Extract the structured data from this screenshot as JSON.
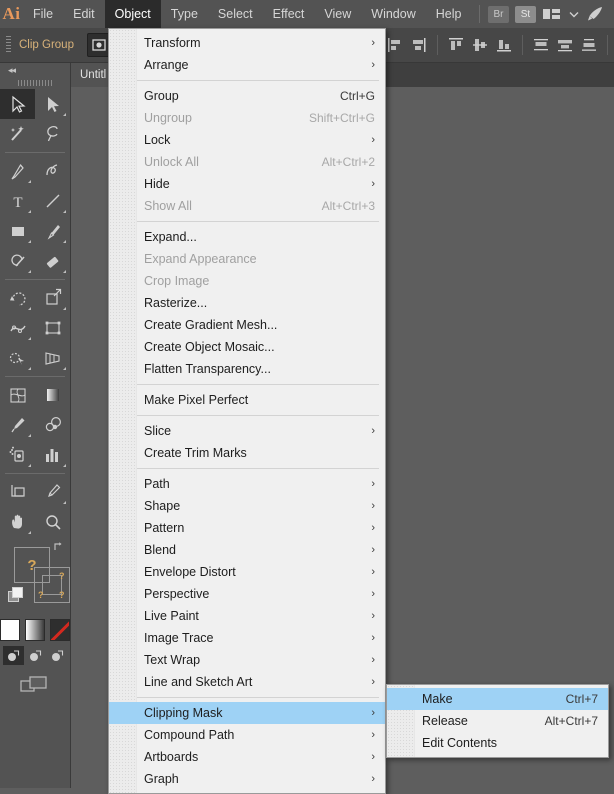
{
  "app": {
    "logo": "Ai"
  },
  "menubar": {
    "items": [
      {
        "label": "File",
        "active": false
      },
      {
        "label": "Edit",
        "active": false
      },
      {
        "label": "Object",
        "active": true
      },
      {
        "label": "Type",
        "active": false
      },
      {
        "label": "Select",
        "active": false
      },
      {
        "label": "Effect",
        "active": false
      },
      {
        "label": "View",
        "active": false
      },
      {
        "label": "Window",
        "active": false
      },
      {
        "label": "Help",
        "active": false
      }
    ],
    "right_icons": [
      {
        "name": "bridge-icon",
        "label": "Br"
      },
      {
        "name": "stock-icon",
        "label": "St"
      },
      {
        "name": "workspace-switcher-icon",
        "label": ""
      },
      {
        "name": "chevron-down-icon",
        "label": "⌄"
      },
      {
        "name": "discover-rocket-icon",
        "label": ""
      }
    ]
  },
  "controlbar": {
    "selection_label": "Clip Group",
    "buttons": [
      {
        "name": "isolate-selected-object-button"
      },
      {
        "name": "align-left-button"
      },
      {
        "name": "align-horizontal-center-button"
      },
      {
        "name": "align-right-button"
      },
      {
        "name": "align-top-button"
      },
      {
        "name": "align-vertical-center-button"
      },
      {
        "name": "align-bottom-button"
      },
      {
        "name": "distribute-top-button"
      },
      {
        "name": "distribute-vertical-center-button"
      },
      {
        "name": "distribute-bottom-button"
      }
    ]
  },
  "document": {
    "tab_label": "Untitl"
  },
  "toolbar": {
    "collapse_label": "◂◂",
    "tools": [
      {
        "name": "selection-tool",
        "selected": true,
        "corner": false
      },
      {
        "name": "direct-selection-tool",
        "selected": false,
        "corner": true
      },
      {
        "name": "magic-wand-tool",
        "selected": false,
        "corner": false
      },
      {
        "name": "lasso-tool",
        "selected": false,
        "corner": false
      },
      {
        "name": "pen-tool",
        "selected": false,
        "corner": true
      },
      {
        "name": "curvature-tool",
        "selected": false,
        "corner": false
      },
      {
        "name": "type-tool",
        "selected": false,
        "corner": true
      },
      {
        "name": "line-segment-tool",
        "selected": false,
        "corner": true
      },
      {
        "name": "rectangle-tool",
        "selected": false,
        "corner": true
      },
      {
        "name": "paintbrush-tool",
        "selected": false,
        "corner": true
      },
      {
        "name": "shaper-tool",
        "selected": false,
        "corner": true
      },
      {
        "name": "eraser-tool",
        "selected": false,
        "corner": true
      },
      {
        "name": "rotate-tool",
        "selected": false,
        "corner": true
      },
      {
        "name": "scale-tool",
        "selected": false,
        "corner": true
      },
      {
        "name": "width-tool",
        "selected": false,
        "corner": true
      },
      {
        "name": "free-transform-tool",
        "selected": false,
        "corner": false
      },
      {
        "name": "shape-builder-tool",
        "selected": false,
        "corner": true
      },
      {
        "name": "perspective-grid-tool",
        "selected": false,
        "corner": true
      },
      {
        "name": "mesh-tool",
        "selected": false,
        "corner": false
      },
      {
        "name": "gradient-tool",
        "selected": false,
        "corner": false
      },
      {
        "name": "eyedropper-tool",
        "selected": false,
        "corner": true
      },
      {
        "name": "blend-tool",
        "selected": false,
        "corner": false
      },
      {
        "name": "symbol-sprayer-tool",
        "selected": false,
        "corner": true
      },
      {
        "name": "column-graph-tool",
        "selected": false,
        "corner": true
      },
      {
        "name": "artboard-tool",
        "selected": false,
        "corner": false
      },
      {
        "name": "slice-tool",
        "selected": false,
        "corner": true
      },
      {
        "name": "hand-tool",
        "selected": false,
        "corner": true
      },
      {
        "name": "zoom-tool",
        "selected": false,
        "corner": false
      }
    ],
    "fill_stroke": {
      "fill_indicator": "?",
      "stroke_indicator_1": "?",
      "stroke_indicator_2": "?",
      "stroke_indicator_3": "?",
      "swap_icon": "↰"
    },
    "color_modes": [
      {
        "name": "color-swatch-button",
        "kind": "white"
      },
      {
        "name": "gradient-swatch-button",
        "kind": "gradient"
      },
      {
        "name": "none-swatch-button",
        "kind": "none"
      }
    ],
    "draw_modes": [
      {
        "name": "draw-normal-button",
        "selected": true
      },
      {
        "name": "draw-behind-button",
        "selected": false
      },
      {
        "name": "draw-inside-button",
        "selected": false
      }
    ],
    "screen_mode": {
      "name": "change-screen-mode-button"
    }
  },
  "object_menu": {
    "items": [
      {
        "label": "Transform",
        "shortcut": "",
        "submenu": true,
        "disabled": false,
        "highlighted": false
      },
      {
        "label": "Arrange",
        "shortcut": "",
        "submenu": true,
        "disabled": false,
        "highlighted": false
      },
      {
        "separator": true
      },
      {
        "label": "Group",
        "shortcut": "Ctrl+G",
        "submenu": false,
        "disabled": false,
        "highlighted": false
      },
      {
        "label": "Ungroup",
        "shortcut": "Shift+Ctrl+G",
        "submenu": false,
        "disabled": true,
        "highlighted": false
      },
      {
        "label": "Lock",
        "shortcut": "",
        "submenu": true,
        "disabled": false,
        "highlighted": false
      },
      {
        "label": "Unlock All",
        "shortcut": "Alt+Ctrl+2",
        "submenu": false,
        "disabled": true,
        "highlighted": false
      },
      {
        "label": "Hide",
        "shortcut": "",
        "submenu": true,
        "disabled": false,
        "highlighted": false
      },
      {
        "label": "Show All",
        "shortcut": "Alt+Ctrl+3",
        "submenu": false,
        "disabled": true,
        "highlighted": false
      },
      {
        "separator": true
      },
      {
        "label": "Expand...",
        "shortcut": "",
        "submenu": false,
        "disabled": false,
        "highlighted": false
      },
      {
        "label": "Expand Appearance",
        "shortcut": "",
        "submenu": false,
        "disabled": true,
        "highlighted": false
      },
      {
        "label": "Crop Image",
        "shortcut": "",
        "submenu": false,
        "disabled": true,
        "highlighted": false
      },
      {
        "label": "Rasterize...",
        "shortcut": "",
        "submenu": false,
        "disabled": false,
        "highlighted": false
      },
      {
        "label": "Create Gradient Mesh...",
        "shortcut": "",
        "submenu": false,
        "disabled": false,
        "highlighted": false
      },
      {
        "label": "Create Object Mosaic...",
        "shortcut": "",
        "submenu": false,
        "disabled": false,
        "highlighted": false
      },
      {
        "label": "Flatten Transparency...",
        "shortcut": "",
        "submenu": false,
        "disabled": false,
        "highlighted": false
      },
      {
        "separator": true
      },
      {
        "label": "Make Pixel Perfect",
        "shortcut": "",
        "submenu": false,
        "disabled": false,
        "highlighted": false
      },
      {
        "separator": true
      },
      {
        "label": "Slice",
        "shortcut": "",
        "submenu": true,
        "disabled": false,
        "highlighted": false
      },
      {
        "label": "Create Trim Marks",
        "shortcut": "",
        "submenu": false,
        "disabled": false,
        "highlighted": false
      },
      {
        "separator": true
      },
      {
        "label": "Path",
        "shortcut": "",
        "submenu": true,
        "disabled": false,
        "highlighted": false
      },
      {
        "label": "Shape",
        "shortcut": "",
        "submenu": true,
        "disabled": false,
        "highlighted": false
      },
      {
        "label": "Pattern",
        "shortcut": "",
        "submenu": true,
        "disabled": false,
        "highlighted": false
      },
      {
        "label": "Blend",
        "shortcut": "",
        "submenu": true,
        "disabled": false,
        "highlighted": false
      },
      {
        "label": "Envelope Distort",
        "shortcut": "",
        "submenu": true,
        "disabled": false,
        "highlighted": false
      },
      {
        "label": "Perspective",
        "shortcut": "",
        "submenu": true,
        "disabled": false,
        "highlighted": false
      },
      {
        "label": "Live Paint",
        "shortcut": "",
        "submenu": true,
        "disabled": false,
        "highlighted": false
      },
      {
        "label": "Image Trace",
        "shortcut": "",
        "submenu": true,
        "disabled": false,
        "highlighted": false
      },
      {
        "label": "Text Wrap",
        "shortcut": "",
        "submenu": true,
        "disabled": false,
        "highlighted": false
      },
      {
        "label": "Line and Sketch Art",
        "shortcut": "",
        "submenu": true,
        "disabled": false,
        "highlighted": false
      },
      {
        "separator": true
      },
      {
        "label": "Clipping Mask",
        "shortcut": "",
        "submenu": true,
        "disabled": false,
        "highlighted": true
      },
      {
        "label": "Compound Path",
        "shortcut": "",
        "submenu": true,
        "disabled": false,
        "highlighted": false
      },
      {
        "label": "Artboards",
        "shortcut": "",
        "submenu": true,
        "disabled": false,
        "highlighted": false
      },
      {
        "label": "Graph",
        "shortcut": "",
        "submenu": true,
        "disabled": false,
        "highlighted": false
      }
    ]
  },
  "clipping_mask_submenu": {
    "items": [
      {
        "label": "Make",
        "shortcut": "Ctrl+7",
        "disabled": false,
        "highlighted": true
      },
      {
        "label": "Release",
        "shortcut": "Alt+Ctrl+7",
        "disabled": false,
        "highlighted": false
      },
      {
        "label": "Edit Contents",
        "shortcut": "",
        "disabled": false,
        "highlighted": false
      }
    ]
  },
  "colors": {
    "menubar_bg": "#535353",
    "menu_bg": "#f0f0f0",
    "highlight": "#9ed2f5",
    "canvas_bg": "#5e5e5e",
    "accent_orange": "#e8995c",
    "clip_group_label": "#d8b27a"
  }
}
